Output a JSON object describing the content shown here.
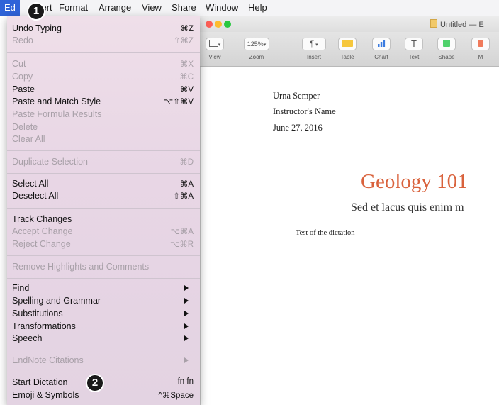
{
  "menubar": {
    "edit": "Ed",
    "items": [
      "sert",
      "Format",
      "Arrange",
      "View",
      "Share",
      "Window",
      "Help"
    ]
  },
  "window": {
    "title": "Untitled — E",
    "toolbar": {
      "zoom_value": "125%",
      "labels": [
        "View",
        "Zoom",
        "Insert",
        "Table",
        "Chart",
        "Text",
        "Shape",
        "M"
      ]
    }
  },
  "document": {
    "author": "Urna Semper",
    "instructor": "Instructor's Name",
    "date": "June 27, 2016",
    "title": "Geology 101",
    "subtitle": "Sed et lacus quis enim m",
    "body": "Test of the dictation",
    "colors": {
      "title": "#d9623c"
    }
  },
  "menu": {
    "undo": {
      "label": "Undo Typing",
      "shortcut": "⌘Z"
    },
    "redo": {
      "label": "Redo",
      "shortcut": "⇧⌘Z"
    },
    "cut": {
      "label": "Cut",
      "shortcut": "⌘X"
    },
    "copy": {
      "label": "Copy",
      "shortcut": "⌘C"
    },
    "paste": {
      "label": "Paste",
      "shortcut": "⌘V"
    },
    "paste_match": {
      "label": "Paste and Match Style",
      "shortcut": "⌥⇧⌘V"
    },
    "paste_formula": {
      "label": "Paste Formula Results"
    },
    "delete": {
      "label": "Delete"
    },
    "clear_all": {
      "label": "Clear All"
    },
    "duplicate": {
      "label": "Duplicate Selection",
      "shortcut": "⌘D"
    },
    "select_all": {
      "label": "Select All",
      "shortcut": "⌘A"
    },
    "deselect_all": {
      "label": "Deselect All",
      "shortcut": "⇧⌘A"
    },
    "track_changes": {
      "label": "Track Changes"
    },
    "accept_change": {
      "label": "Accept Change",
      "shortcut": "⌥⌘A"
    },
    "reject_change": {
      "label": "Reject Change",
      "shortcut": "⌥⌘R"
    },
    "remove_highlights": {
      "label": "Remove Highlights and Comments"
    },
    "find": {
      "label": "Find"
    },
    "spelling": {
      "label": "Spelling and Grammar"
    },
    "substitutions": {
      "label": "Substitutions"
    },
    "transformations": {
      "label": "Transformations"
    },
    "speech": {
      "label": "Speech"
    },
    "endnote": {
      "label": "EndNote Citations"
    },
    "start_dictation": {
      "label": "Start Dictation",
      "shortcut": "fn fn"
    },
    "emoji": {
      "label": "Emoji & Symbols",
      "shortcut": "^⌘Space"
    }
  },
  "badges": {
    "one": "1",
    "two": "2"
  }
}
